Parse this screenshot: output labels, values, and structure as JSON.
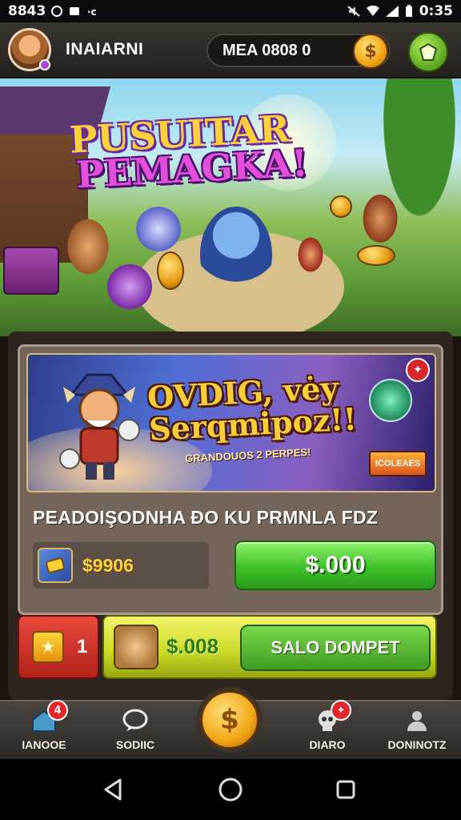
{
  "status_bar": {
    "left_text": "8843",
    "time": "0:35"
  },
  "top_bar": {
    "player_name": "INAIARNI",
    "currency_text": "MEA 0808 0",
    "coin_symbol": "$"
  },
  "hero": {
    "title_line1": "PUSUITAR",
    "title_line2": "PEMAGKA!"
  },
  "offer": {
    "headline": "OVDIG, vėy Serqmipoz!!",
    "subline": "GRANDOUOS 2 PERPES!",
    "badge": "✦",
    "mini_logo": "ICOLEAES",
    "description": "PEADOIŞODNHA ĐO KU PRMNLA FDZ",
    "cost": "$9906",
    "buy_label": "$.000"
  },
  "reward_row": {
    "count": "1",
    "price": "$.008",
    "claim_label": "SALO DOMPET"
  },
  "bottom_nav": {
    "items": [
      {
        "label": "IANOOE",
        "icon": "home-icon",
        "badge": "4"
      },
      {
        "label": "SODIIC",
        "icon": "chat-icon",
        "badge": ""
      },
      {
        "label": "DIARO",
        "icon": "skull-icon",
        "badge": "✦"
      },
      {
        "label": "DONINOTZ",
        "icon": "person-icon",
        "badge": ""
      }
    ],
    "center_symbol": "$"
  },
  "colors": {
    "buy_green": "#3fc12a",
    "coin_gold": "#f2a515",
    "badge_red": "#e4262a"
  }
}
